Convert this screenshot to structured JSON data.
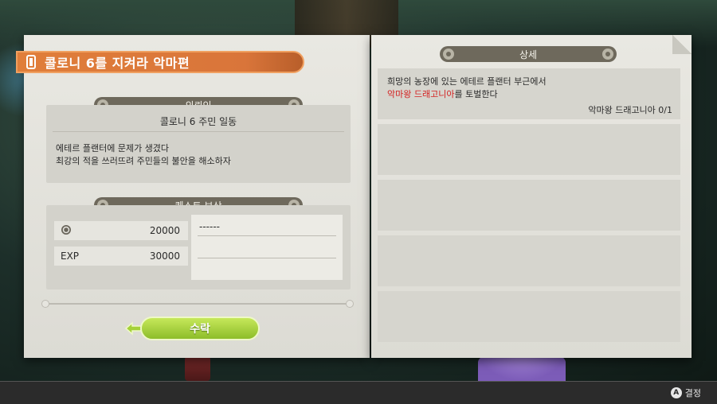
{
  "quest": {
    "title": "콜로니 6를 지켜라 악마편",
    "client_header": "의뢰인",
    "client_name": "콜로니 6 주민 일동",
    "description": [
      "에테르 플랜터에 문제가 생겼다",
      "최강의 적을 쓰러뜨려 주민들의 불안을 해소하자"
    ],
    "reward_header": "퀘스트 보상",
    "rewards": [
      {
        "icon": "coin-icon",
        "label": "",
        "value": "20000"
      },
      {
        "icon": "",
        "label": "EXP",
        "value": "30000"
      }
    ],
    "reward_item": "------",
    "accept_label": "수락"
  },
  "detail": {
    "header": "상세",
    "line1": "희망의 농장에 있는 에테르 플랜터 부근에서",
    "target": "악마왕 드래고니아",
    "line2_suffix": "를 토벌한다",
    "progress": "악마왕 드래고니아 0/1"
  },
  "footer": {
    "button": "A",
    "hint": "결정"
  },
  "colors": {
    "banner": "#d9753a",
    "accept": "#a5d13a",
    "target_text": "#d42020"
  }
}
